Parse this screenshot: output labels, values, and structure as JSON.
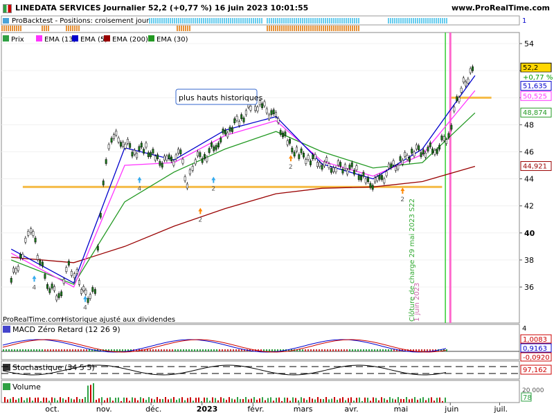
{
  "header": {
    "title": "LINEDATA SERVICES Journalier 52,2 (+0,77 %) 16 juin 2023 10:01:55",
    "brand": "www.ProRealTime.com"
  },
  "backtest": {
    "label": "ProBacktest - Positions: croisement jour",
    "right_value": "1"
  },
  "legend": {
    "items": [
      {
        "label": "Prix",
        "color": "#2ea043"
      },
      {
        "label": "EMA (13)",
        "color": "#ff33ff"
      },
      {
        "label": "EMA (5)",
        "color": "#0000cc"
      },
      {
        "label": "EMA (200)",
        "color": "#990000"
      },
      {
        "label": "EMA (30)",
        "color": "#229922"
      }
    ]
  },
  "price_panel": {
    "annotation": "plus hauts historiques",
    "footer_left": "ProRealTime.com",
    "footer_note": "Historique ajusté aux dividendes",
    "vline_label_1": "Clôture de charge 29 mai 2023 S22",
    "vline_label_2": "1 juin 2023",
    "y_ticks": [
      "54",
      "52",
      "50",
      "48",
      "46",
      "44",
      "42",
      "40",
      "38",
      "36"
    ],
    "value_tags": [
      {
        "text": "52,2",
        "bg": "#ffd700",
        "fg": "#000000",
        "border": "#000000",
        "price": 52.2
      },
      {
        "text": "+0,77 %",
        "bg": "#ffffff",
        "fg": "#009900",
        "border": "#ffffff",
        "price": 51.5
      },
      {
        "text": "51,635",
        "bg": "#ffffff",
        "fg": "#0000cc",
        "border": "#0000cc",
        "price": 50.85
      },
      {
        "text": "50,525",
        "bg": "#ffffff",
        "fg": "#ff33ff",
        "border": "#ff33ff",
        "price": 50.1
      },
      {
        "text": "48,874",
        "bg": "#ffffff",
        "fg": "#229922",
        "border": "#229922",
        "price": 48.874
      },
      {
        "text": "44,921",
        "bg": "#ffffff",
        "fg": "#990000",
        "border": "#990000",
        "price": 44.921
      }
    ],
    "marker_numbers": [
      "4",
      "2",
      "2",
      "2",
      "2",
      "4",
      "4"
    ]
  },
  "macd_panel": {
    "label": "MACD Zéro Retard (12 26 9)",
    "tick_top": "4",
    "tags": [
      {
        "text": "1,0083",
        "fg": "#cc0000"
      },
      {
        "text": "0,9163",
        "fg": "#0000cc"
      },
      {
        "text": "-0,0920",
        "fg": "#cc0000"
      }
    ]
  },
  "stoch_panel": {
    "label": "Stochastique (34 5 5)",
    "tag": "97,162"
  },
  "volume_panel": {
    "label": "Volume",
    "tick": "20 000",
    "tag": "78"
  },
  "x_axis": {
    "labels": [
      "oct.",
      "nov.",
      "déc.",
      "2023",
      "févr.",
      "mars",
      "avr.",
      "mai",
      "juin",
      "juil."
    ]
  },
  "chart_data": {
    "type": "candlestick",
    "title": "LINEDATA SERVICES Journalier",
    "ylim": [
      35,
      55
    ],
    "series": [
      {
        "name": "Prix",
        "values": [
          {
            "x": "2022-09-07",
            "y": 36.5
          },
          {
            "x": "2022-09-14",
            "y": 38.5
          },
          {
            "x": "2022-09-19",
            "y": 40.5
          },
          {
            "x": "2022-09-23",
            "y": 38.5
          },
          {
            "x": "2022-09-29",
            "y": 36.2
          },
          {
            "x": "2022-10-06",
            "y": 35.3
          },
          {
            "x": "2022-10-12",
            "y": 37.5
          },
          {
            "x": "2022-10-17",
            "y": 36.8
          },
          {
            "x": "2022-10-21",
            "y": 35.6
          },
          {
            "x": "2022-10-25",
            "y": 35.2
          },
          {
            "x": "2022-10-28",
            "y": 35.8
          },
          {
            "x": "2022-11-02",
            "y": 44
          },
          {
            "x": "2022-11-07",
            "y": 47.2
          },
          {
            "x": "2022-11-14",
            "y": 46.8
          },
          {
            "x": "2022-11-21",
            "y": 46
          },
          {
            "x": "2022-11-28",
            "y": 46.3
          },
          {
            "x": "2022-12-05",
            "y": 45.3
          },
          {
            "x": "2022-12-12",
            "y": 45.3
          },
          {
            "x": "2022-12-19",
            "y": 45.8
          },
          {
            "x": "2022-12-23",
            "y": 43.5
          },
          {
            "x": "2022-12-28",
            "y": 45.5
          },
          {
            "x": "2023-01-04",
            "y": 45.8
          },
          {
            "x": "2023-01-11",
            "y": 46.8
          },
          {
            "x": "2023-01-18",
            "y": 47.8
          },
          {
            "x": "2023-01-25",
            "y": 48.5
          },
          {
            "x": "2023-02-01",
            "y": 49.5
          },
          {
            "x": "2023-02-08",
            "y": 49.2
          },
          {
            "x": "2023-02-15",
            "y": 48.5
          },
          {
            "x": "2023-02-22",
            "y": 46.6
          },
          {
            "x": "2023-03-01",
            "y": 45.8
          },
          {
            "x": "2023-03-08",
            "y": 45.5
          },
          {
            "x": "2023-03-15",
            "y": 45.2
          },
          {
            "x": "2023-03-22",
            "y": 44.9
          },
          {
            "x": "2023-03-29",
            "y": 44.9
          },
          {
            "x": "2023-04-05",
            "y": 44.6
          },
          {
            "x": "2023-04-12",
            "y": 43.6
          },
          {
            "x": "2023-04-19",
            "y": 43.8
          },
          {
            "x": "2023-04-26",
            "y": 44.8
          },
          {
            "x": "2023-05-03",
            "y": 45.3
          },
          {
            "x": "2023-05-10",
            "y": 46.1
          },
          {
            "x": "2023-05-17",
            "y": 46.1
          },
          {
            "x": "2023-05-24",
            "y": 46.3
          },
          {
            "x": "2023-05-31",
            "y": 47.3
          },
          {
            "x": "2023-06-05",
            "y": 49.8
          },
          {
            "x": "2023-06-09",
            "y": 51
          },
          {
            "x": "2023-06-16",
            "y": 52.2
          }
        ]
      },
      {
        "name": "EMA (200)",
        "values": [
          {
            "x": "2022-09-07",
            "y": 38.2
          },
          {
            "x": "2022-10-15",
            "y": 37.8
          },
          {
            "x": "2022-11-15",
            "y": 39
          },
          {
            "x": "2022-12-15",
            "y": 40.5
          },
          {
            "x": "2023-01-15",
            "y": 41.8
          },
          {
            "x": "2023-02-15",
            "y": 42.9
          },
          {
            "x": "2023-03-15",
            "y": 43.3
          },
          {
            "x": "2023-04-15",
            "y": 43.4
          },
          {
            "x": "2023-05-15",
            "y": 43.8
          },
          {
            "x": "2023-06-16",
            "y": 44.921
          }
        ]
      },
      {
        "name": "EMA (30)",
        "values": [
          {
            "x": "2022-09-07",
            "y": 38
          },
          {
            "x": "2022-10-15",
            "y": 36.2
          },
          {
            "x": "2022-11-15",
            "y": 42.3
          },
          {
            "x": "2022-12-15",
            "y": 44.5
          },
          {
            "x": "2023-01-15",
            "y": 46.2
          },
          {
            "x": "2023-02-15",
            "y": 47.5
          },
          {
            "x": "2023-03-15",
            "y": 46
          },
          {
            "x": "2023-04-15",
            "y": 44.8
          },
          {
            "x": "2023-05-15",
            "y": 45.2
          },
          {
            "x": "2023-06-16",
            "y": 48.874
          }
        ]
      },
      {
        "name": "EMA (13)",
        "values": [
          {
            "x": "2022-09-07",
            "y": 38.5
          },
          {
            "x": "2022-10-15",
            "y": 36
          },
          {
            "x": "2022-11-15",
            "y": 45
          },
          {
            "x": "2022-12-15",
            "y": 45.2
          },
          {
            "x": "2023-01-15",
            "y": 47.2
          },
          {
            "x": "2023-02-15",
            "y": 48.3
          },
          {
            "x": "2023-03-15",
            "y": 45.3
          },
          {
            "x": "2023-04-15",
            "y": 44.2
          },
          {
            "x": "2023-05-15",
            "y": 45.8
          },
          {
            "x": "2023-06-16",
            "y": 50.525
          }
        ]
      },
      {
        "name": "EMA (5)",
        "values": [
          {
            "x": "2022-09-07",
            "y": 38.8
          },
          {
            "x": "2022-10-15",
            "y": 36.3
          },
          {
            "x": "2022-11-15",
            "y": 46.3
          },
          {
            "x": "2022-12-15",
            "y": 45.4
          },
          {
            "x": "2023-01-15",
            "y": 47.6
          },
          {
            "x": "2023-02-15",
            "y": 48.6
          },
          {
            "x": "2023-03-15",
            "y": 45.1
          },
          {
            "x": "2023-04-15",
            "y": 44
          },
          {
            "x": "2023-05-15",
            "y": 46.2
          },
          {
            "x": "2023-06-16",
            "y": 51.635
          }
        ]
      }
    ],
    "horizontal_lines": [
      {
        "y": 50,
        "from": "2023-06-01",
        "to": "2023-06-26"
      },
      {
        "y": 43.4,
        "from": "2022-09-14",
        "to": "2023-05-27"
      }
    ],
    "vertical_lines": [
      {
        "x": "2023-05-29",
        "color": "#33cc33"
      },
      {
        "x": "2023-06-01",
        "color": "#ff66cc"
      }
    ]
  }
}
